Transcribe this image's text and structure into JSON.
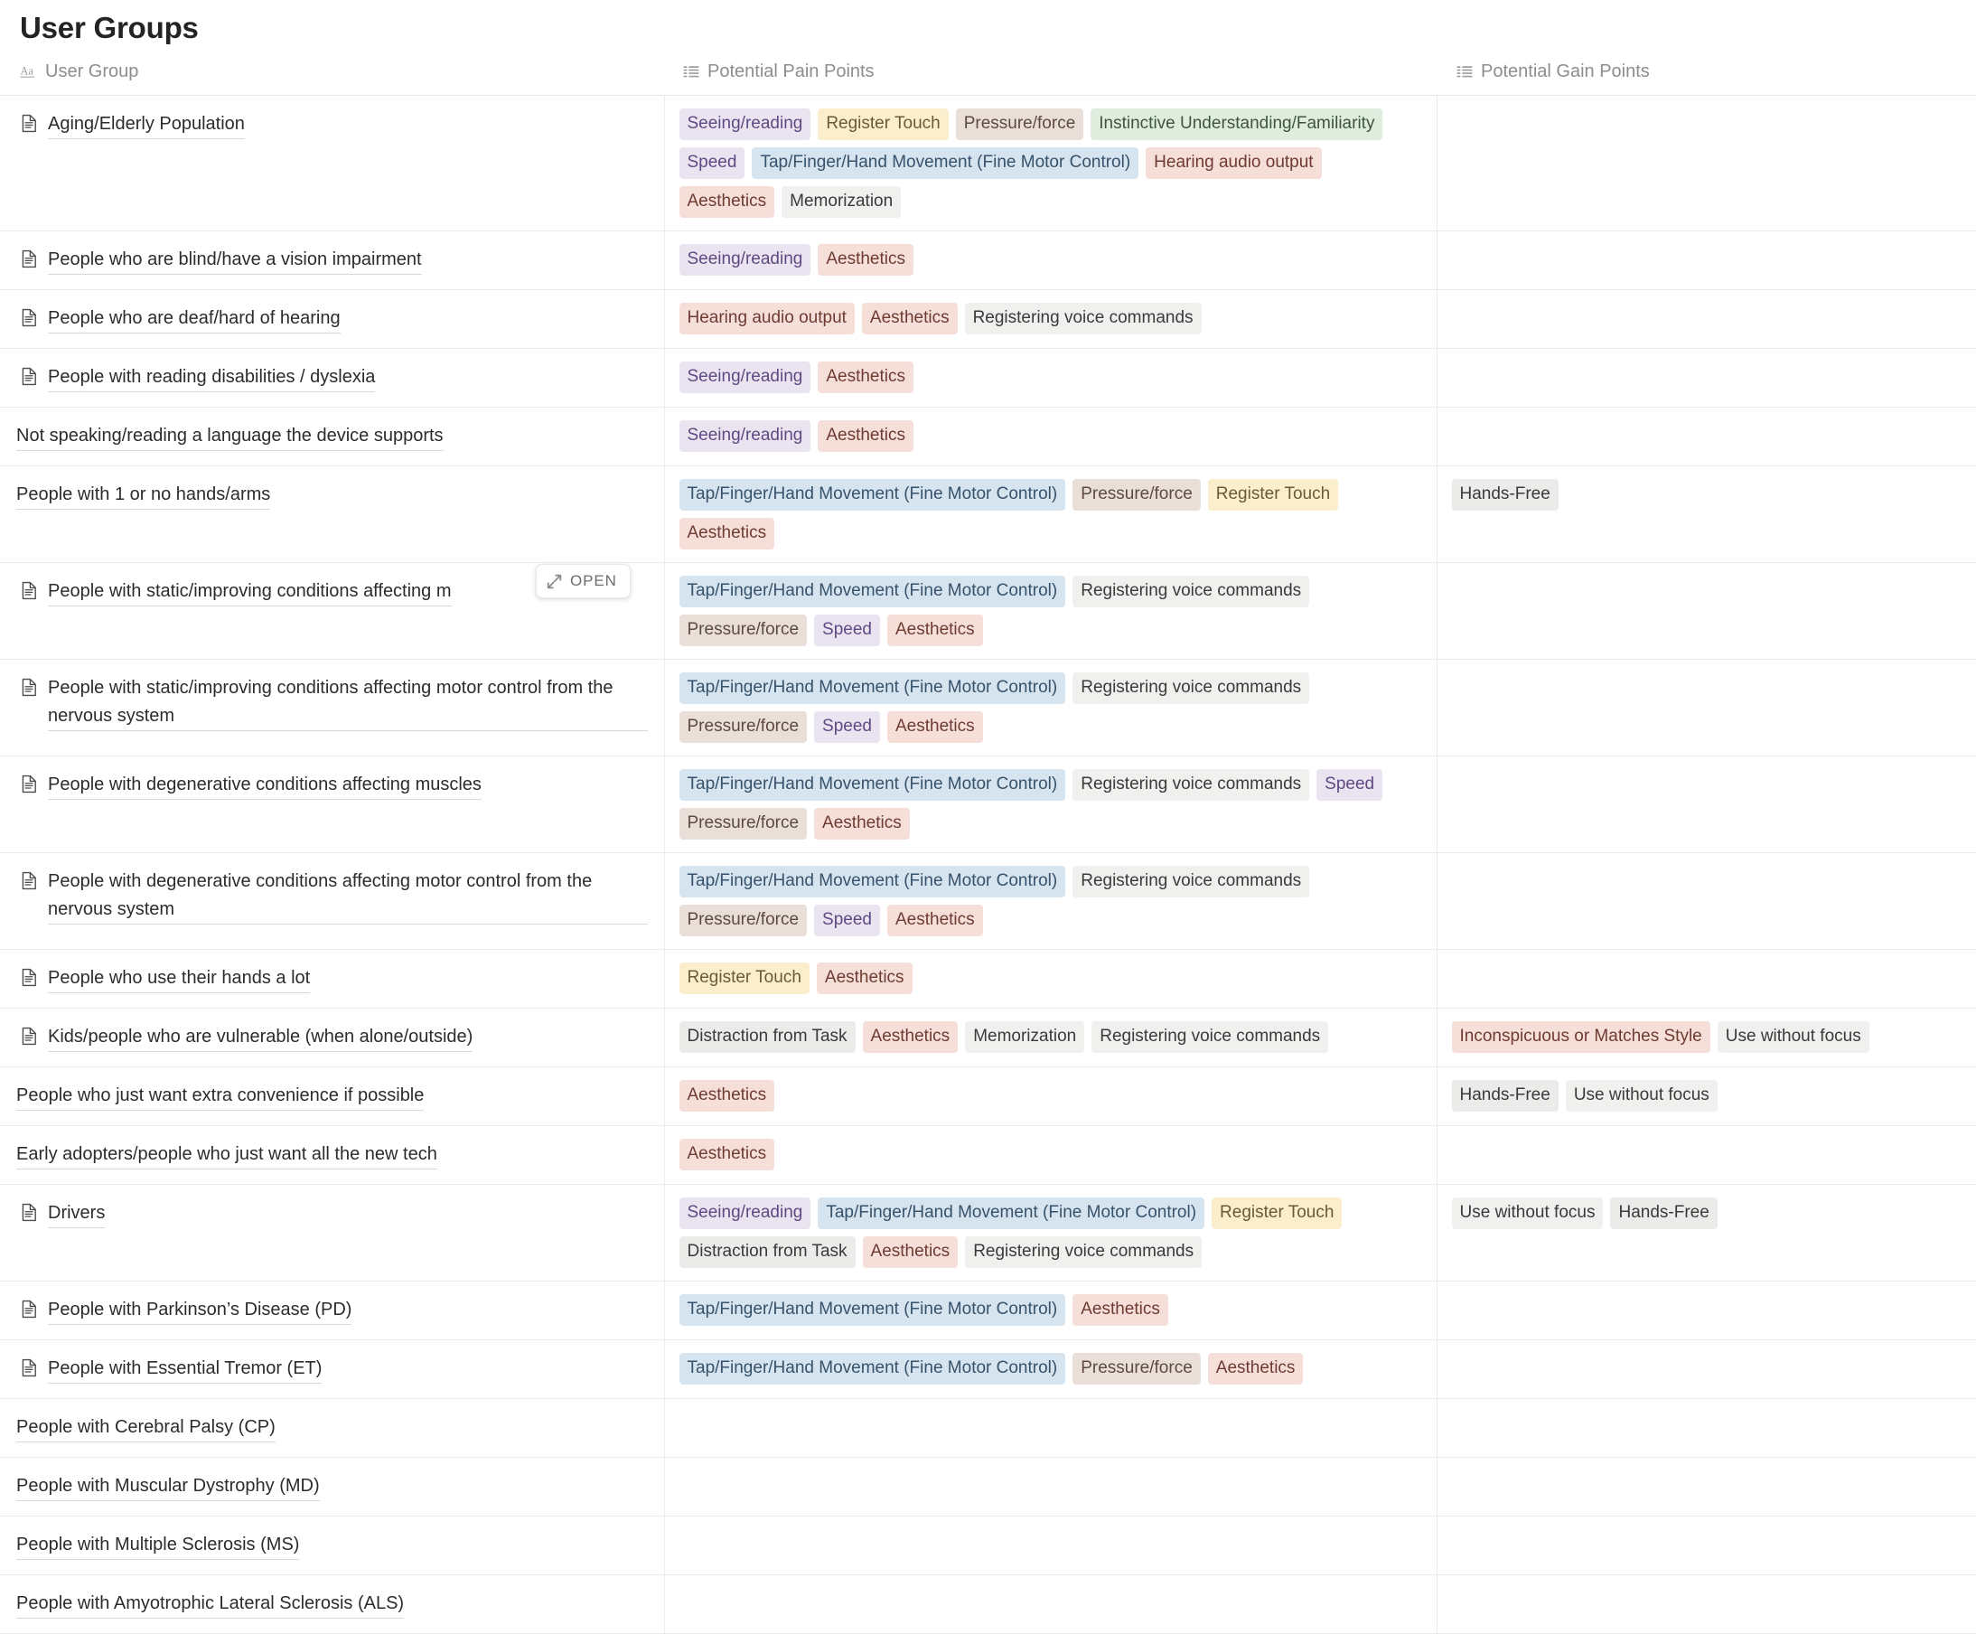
{
  "page": {
    "title": "User Groups"
  },
  "columns": [
    {
      "label": "User Group",
      "icon": "title-text-icon",
      "key": "name"
    },
    {
      "label": "Potential Pain Points",
      "icon": "multi-select-icon",
      "key": "pain"
    },
    {
      "label": "Potential Gain Points",
      "icon": "multi-select-icon",
      "key": "gain"
    }
  ],
  "hover": {
    "open_label": "OPEN",
    "open_icon": "expand-diagonal-icon",
    "on_row_index": 6
  },
  "tag_colors": {
    "Seeing/reading": "purple",
    "Register Touch": "yellow",
    "Pressure/force": "brown",
    "Instinctive Understanding/Familiarity": "green",
    "Speed": "purple",
    "Tap/Finger/Hand Movement (Fine Motor Control)": "blue",
    "Hearing audio output": "red",
    "Aesthetics": "red",
    "Memorization": "lgray",
    "Registering voice commands": "lgray",
    "Distraction from Task": "gray",
    "Hands-Free": "gray",
    "Use without focus": "lgray",
    "Inconspicuous or Matches Style": "red"
  },
  "rows": [
    {
      "name": "Aging/Elderly Population",
      "has_icon": true,
      "pain": [
        "Seeing/reading",
        "Register Touch",
        "Pressure/force",
        "Instinctive Understanding/Familiarity",
        "Speed",
        "Tap/Finger/Hand Movement (Fine Motor Control)",
        "Hearing audio output",
        "Aesthetics",
        "Memorization"
      ],
      "gain": []
    },
    {
      "name": "People who are blind/have a vision impairment",
      "has_icon": true,
      "pain": [
        "Seeing/reading",
        "Aesthetics"
      ],
      "gain": []
    },
    {
      "name": "People who are deaf/hard of hearing",
      "has_icon": true,
      "pain": [
        "Hearing audio output",
        "Aesthetics",
        "Registering voice commands"
      ],
      "gain": []
    },
    {
      "name": "People with reading disabilities / dyslexia",
      "has_icon": true,
      "pain": [
        "Seeing/reading",
        "Aesthetics"
      ],
      "gain": []
    },
    {
      "name": "Not speaking/reading a language the device supports",
      "has_icon": false,
      "pain": [
        "Seeing/reading",
        "Aesthetics"
      ],
      "gain": []
    },
    {
      "name": "People with 1 or no hands/arms",
      "has_icon": false,
      "pain": [
        "Tap/Finger/Hand Movement (Fine Motor Control)",
        "Pressure/force",
        "Register Touch",
        "Aesthetics"
      ],
      "gain": [
        "Hands-Free"
      ]
    },
    {
      "name": "People with static/improving conditions affecting m",
      "has_icon": true,
      "pain": [
        "Tap/Finger/Hand Movement (Fine Motor Control)",
        "Registering voice commands",
        "Pressure/force",
        "Speed",
        "Aesthetics"
      ],
      "gain": []
    },
    {
      "name": "People with static/improving conditions affecting motor control from the nervous system",
      "has_icon": true,
      "pain": [
        "Tap/Finger/Hand Movement (Fine Motor Control)",
        "Registering voice commands",
        "Pressure/force",
        "Speed",
        "Aesthetics"
      ],
      "gain": []
    },
    {
      "name": "People with degenerative conditions affecting muscles",
      "has_icon": true,
      "pain": [
        "Tap/Finger/Hand Movement (Fine Motor Control)",
        "Registering voice commands",
        "Speed",
        "Pressure/force",
        "Aesthetics"
      ],
      "gain": []
    },
    {
      "name": "People with degenerative conditions affecting motor control from the nervous system",
      "has_icon": true,
      "pain": [
        "Tap/Finger/Hand Movement (Fine Motor Control)",
        "Registering voice commands",
        "Pressure/force",
        "Speed",
        "Aesthetics"
      ],
      "gain": []
    },
    {
      "name": "People who use their hands a lot",
      "has_icon": true,
      "pain": [
        "Register Touch",
        "Aesthetics"
      ],
      "gain": []
    },
    {
      "name": "Kids/people who are vulnerable (when alone/outside)",
      "has_icon": true,
      "pain": [
        "Distraction from Task",
        "Aesthetics",
        "Memorization",
        "Registering voice commands"
      ],
      "gain": [
        "Inconspicuous or Matches Style",
        "Use without focus"
      ]
    },
    {
      "name": "People who just want extra convenience if possible",
      "has_icon": false,
      "pain": [
        "Aesthetics"
      ],
      "gain": [
        "Hands-Free",
        "Use without focus"
      ]
    },
    {
      "name": "Early adopters/people who just want all the new tech",
      "has_icon": false,
      "pain": [
        "Aesthetics"
      ],
      "gain": []
    },
    {
      "name": "Drivers",
      "has_icon": true,
      "pain": [
        "Seeing/reading",
        "Tap/Finger/Hand Movement (Fine Motor Control)",
        "Register Touch",
        "Distraction from Task",
        "Aesthetics",
        "Registering voice commands"
      ],
      "gain": [
        "Use without focus",
        "Hands-Free"
      ]
    },
    {
      "name": "People with Parkinson’s Disease (PD)",
      "has_icon": true,
      "pain": [
        "Tap/Finger/Hand Movement (Fine Motor Control)",
        "Aesthetics"
      ],
      "gain": []
    },
    {
      "name": "People with Essential Tremor (ET)",
      "has_icon": true,
      "pain": [
        "Tap/Finger/Hand Movement (Fine Motor Control)",
        "Pressure/force",
        "Aesthetics"
      ],
      "gain": []
    },
    {
      "name": "People with Cerebral Palsy (CP)",
      "has_icon": false,
      "pain": [],
      "gain": []
    },
    {
      "name": "People with Muscular Dystrophy (MD)",
      "has_icon": false,
      "pain": [],
      "gain": []
    },
    {
      "name": "People with Multiple Sclerosis (MS)",
      "has_icon": false,
      "pain": [],
      "gain": []
    },
    {
      "name": "People with Amyotrophic Lateral Sclerosis (ALS)",
      "has_icon": false,
      "pain": [],
      "gain": []
    }
  ]
}
